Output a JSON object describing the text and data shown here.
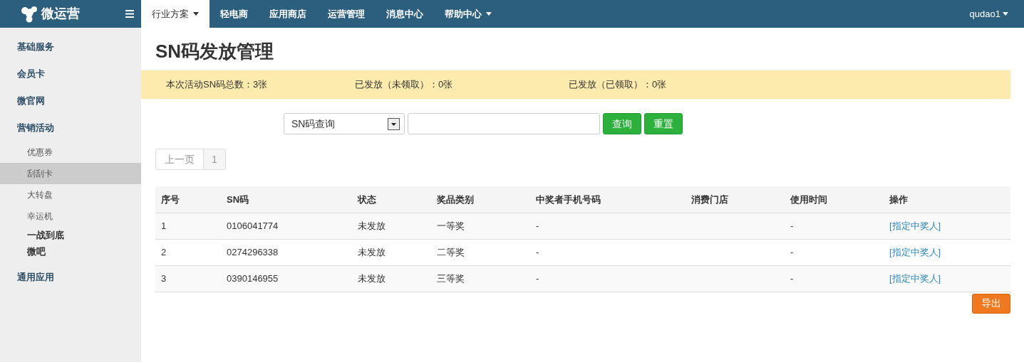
{
  "brand": "微运营",
  "nav": [
    {
      "label": "行业方案",
      "selected": true,
      "dropdown": true
    },
    {
      "label": "轻电商",
      "selected": false,
      "dropdown": false
    },
    {
      "label": "应用商店",
      "selected": false,
      "dropdown": false
    },
    {
      "label": "运营管理",
      "selected": false,
      "dropdown": false
    },
    {
      "label": "消息中心",
      "selected": false,
      "dropdown": false
    },
    {
      "label": "帮助中心",
      "selected": false,
      "dropdown": true
    }
  ],
  "user": "qudao1",
  "sidebar": {
    "items": [
      {
        "label": "基础服务",
        "kind": "group",
        "selected": false
      },
      {
        "label": "会员卡",
        "kind": "group",
        "selected": false
      },
      {
        "label": "微官网",
        "kind": "group",
        "selected": false
      },
      {
        "label": "营销活动",
        "kind": "group",
        "selected": false
      },
      {
        "label": "优惠券",
        "kind": "sub",
        "selected": false
      },
      {
        "label": "刮刮卡",
        "kind": "sub",
        "selected": true
      },
      {
        "label": "大转盘",
        "kind": "sub",
        "selected": false
      },
      {
        "label": "幸运机",
        "kind": "sub",
        "selected": false
      },
      {
        "label": "一战到底",
        "kind": "strong",
        "selected": false
      },
      {
        "label": "微吧",
        "kind": "strong",
        "selected": false
      },
      {
        "label": "通用应用",
        "kind": "group",
        "selected": false
      }
    ]
  },
  "page_title": "SN码发放管理",
  "summary": [
    "本次活动SN码总数：3张",
    "已发放（未领取）：0张",
    "已发放（已领取）：0张"
  ],
  "search": {
    "select": "SN码查询",
    "buttons": [
      "查询",
      "重置"
    ]
  },
  "pagination": {
    "prev": "上一页",
    "pages": [
      "1"
    ]
  },
  "table": {
    "columns": [
      "序号",
      "SN码",
      "状态",
      "奖品类别",
      "中奖者手机号码",
      "消费门店",
      "使用时间",
      "操作"
    ],
    "rows": [
      [
        "1",
        "0106041774",
        "未发放",
        "一等奖",
        "-",
        "",
        "-",
        "[指定中奖人]"
      ],
      [
        "2",
        "0274296338",
        "未发放",
        "二等奖",
        "-",
        "",
        "-",
        "[指定中奖人]"
      ],
      [
        "3",
        "0390146955",
        "未发放",
        "三等奖",
        "-",
        "",
        "-",
        "[指定中奖人]"
      ]
    ]
  },
  "export_button": "导出"
}
